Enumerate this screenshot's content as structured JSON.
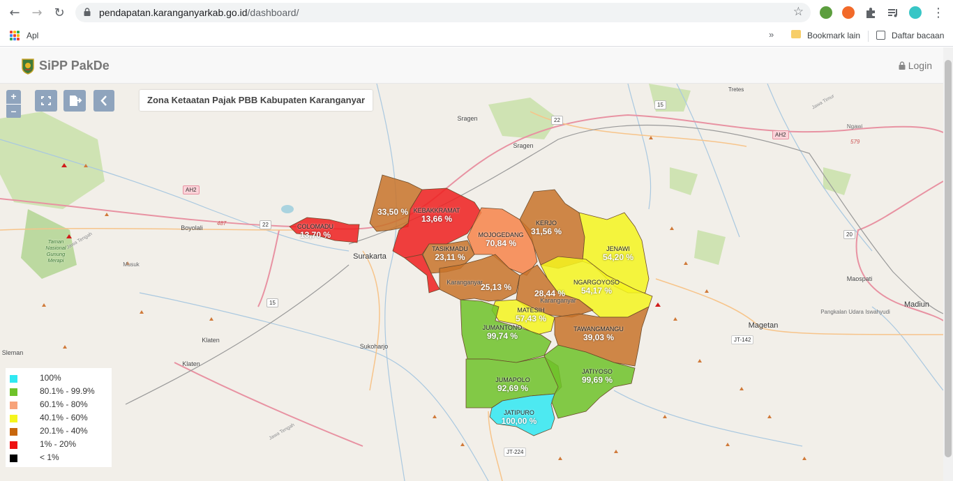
{
  "browser": {
    "url_host": "pendapatan.karanganyarkab.go.id",
    "url_path": "/dashboard/",
    "bookmarks": {
      "apps_label": "Apl",
      "more": "»",
      "other_label": "Bookmark lain",
      "reading_list_label": "Daftar bacaan"
    }
  },
  "header": {
    "brand": "SiPP PakDe",
    "login_label": "Login"
  },
  "map": {
    "title": "Zona Ketaatan Pajak PBB Kabupaten Karanganyar",
    "zoom_in": "+",
    "zoom_out": "–",
    "districts": [
      {
        "name": "",
        "value": "33,50 %",
        "color": "#c8732a"
      },
      {
        "name": "KEBAKKRAMAT",
        "value": "13,66 %",
        "color": "#ee1e1e"
      },
      {
        "name": "COLOMADU",
        "value": "13,70 %",
        "color": "#ee1e1e"
      },
      {
        "name": "TASIKMADU",
        "value": "23,11 %",
        "color": "#c8732a"
      },
      {
        "name": "MOJOGEDANG",
        "value": "70,84 %",
        "color": "#f7844a"
      },
      {
        "name": "KERJO",
        "value": "31,56 %",
        "color": "#c8732a"
      },
      {
        "name": "JENAWI",
        "value": "54,20 %",
        "color": "#f5f51e"
      },
      {
        "name": "NGARGOYOSO",
        "value": "54,17 %",
        "color": "#f5f51e"
      },
      {
        "name": "",
        "value": "25,13 %",
        "color": "#c8732a"
      },
      {
        "name": "",
        "value": "28,44 %",
        "color": "#c8732a"
      },
      {
        "name": "MATESIH",
        "value": "57,43 %",
        "color": "#f5f51e"
      },
      {
        "name": "TAWANGMANGU",
        "value": "39,03 %",
        "color": "#c8732a"
      },
      {
        "name": "JUMANTONO",
        "value": "99,74 %",
        "color": "#6fc229"
      },
      {
        "name": "JUMAPOLO",
        "value": "92,69 %",
        "color": "#6fc229"
      },
      {
        "name": "JATIYOSO",
        "value": "99,69 %",
        "color": "#6fc229"
      },
      {
        "name": "JATIPURO",
        "value": "100,00 %",
        "color": "#30e8f2"
      }
    ],
    "places": [
      "Tretes",
      "Sragen",
      "Sragen",
      "Ngawi",
      "Boyolali",
      "Surakarta",
      "Karanganyar",
      "Karanganyar",
      "Maospati",
      "Madiun",
      "Magetan",
      "Sukoharjo",
      "Klaten",
      "Klaten",
      "Sleman",
      "Musuk",
      "Taman Nasional Gunung Merapi",
      "Pangkalan Udara Iswahyudi",
      "Jawa Tengah",
      "Jawa Tengah",
      "Jawa Timur"
    ],
    "road_labels": [
      "22",
      "22",
      "15",
      "15",
      "20",
      "AH2",
      "AH2",
      "JT-142",
      "JT-224",
      "487",
      "579"
    ]
  },
  "legend": [
    {
      "label": "100%",
      "color": "#30e8f2"
    },
    {
      "label": "80.1% - 99.9%",
      "color": "#6fc229"
    },
    {
      "label": "60.1% - 80%",
      "color": "#f7a37a"
    },
    {
      "label": "40.1% - 60%",
      "color": "#f5f51e"
    },
    {
      "label": "20.1% - 40%",
      "color": "#c8670d"
    },
    {
      "label": "1% - 20%",
      "color": "#ee1111"
    },
    {
      "label": "< 1%",
      "color": "#000000"
    }
  ]
}
